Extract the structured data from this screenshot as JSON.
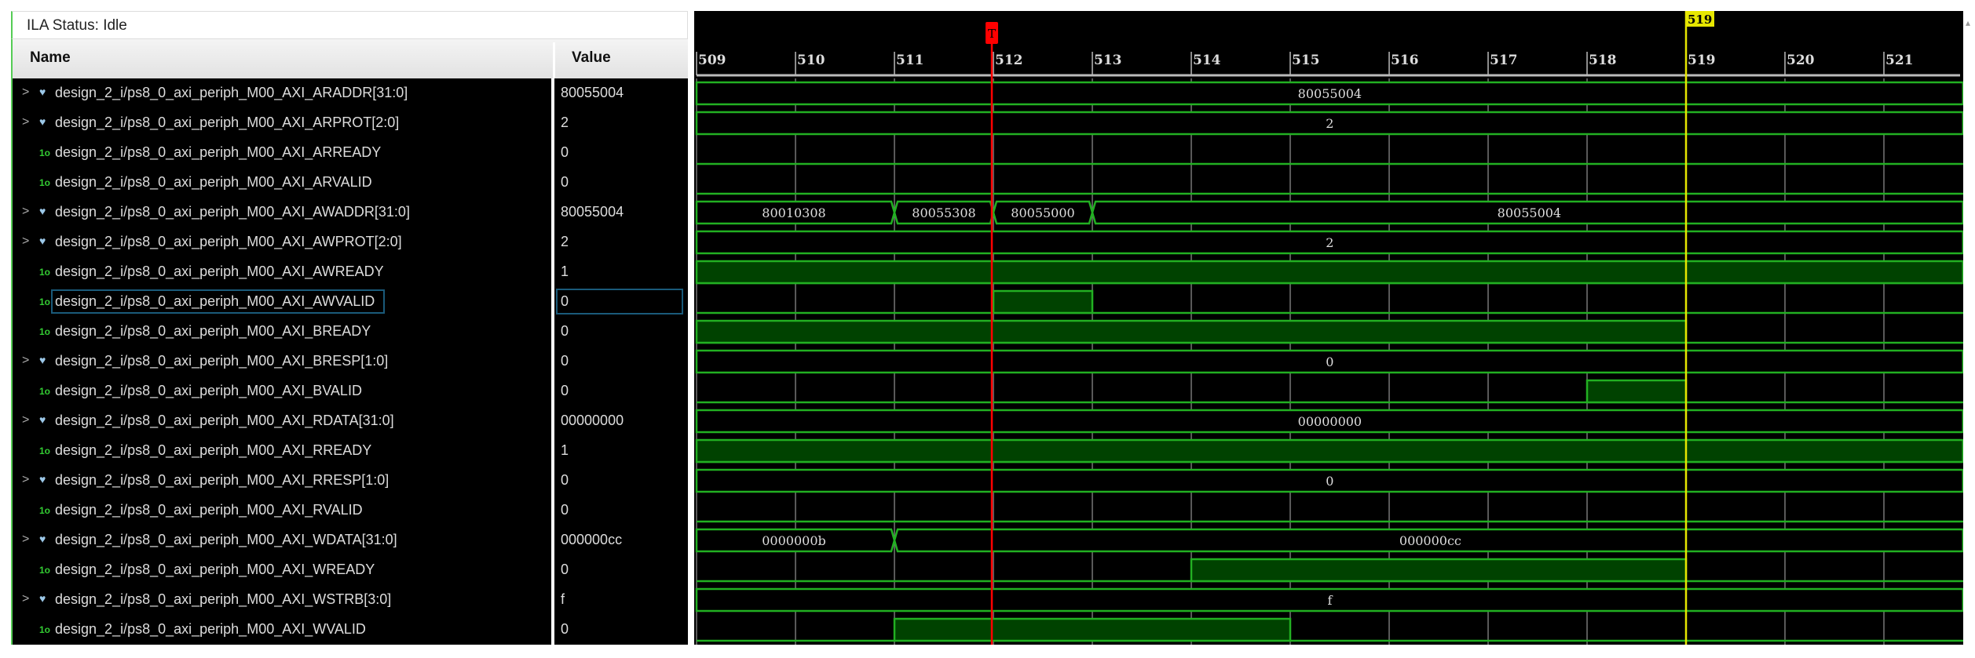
{
  "status": {
    "label": "ILA Status:",
    "value": "Idle"
  },
  "columns": {
    "name": "Name",
    "value": "Value"
  },
  "timeline": {
    "start": 509,
    "end": 521.8,
    "ticks": [
      509,
      510,
      511,
      512,
      513,
      514,
      515,
      516,
      517,
      518,
      519,
      520,
      521
    ]
  },
  "trigger_marker": {
    "label": "T",
    "time": 512,
    "color": "#ff0000"
  },
  "cursor_marker": {
    "label": "519",
    "time": 519,
    "color": "#e6e600"
  },
  "colors": {
    "wave_line": "#22b022",
    "wave_fill": "#004200",
    "grid": "#777777",
    "text": "#dddddd"
  },
  "signals": [
    {
      "name": "design_2_i/ps8_0_axi_periph_M00_AXI_ARADDR[31:0]",
      "value": "80055004",
      "type": "bus",
      "segments": [
        {
          "from": 509,
          "to": 521.8,
          "value": "80055004"
        }
      ]
    },
    {
      "name": "design_2_i/ps8_0_axi_periph_M00_AXI_ARPROT[2:0]",
      "value": "2",
      "type": "bus",
      "segments": [
        {
          "from": 509,
          "to": 521.8,
          "value": "2"
        }
      ]
    },
    {
      "name": "design_2_i/ps8_0_axi_periph_M00_AXI_ARREADY",
      "value": "0",
      "type": "bit",
      "high": []
    },
    {
      "name": "design_2_i/ps8_0_axi_periph_M00_AXI_ARVALID",
      "value": "0",
      "type": "bit",
      "high": []
    },
    {
      "name": "design_2_i/ps8_0_axi_periph_M00_AXI_AWADDR[31:0]",
      "value": "80055004",
      "type": "bus",
      "segments": [
        {
          "from": 509,
          "to": 511,
          "value": "80010308"
        },
        {
          "from": 511,
          "to": 512,
          "value": "80055308"
        },
        {
          "from": 512,
          "to": 513,
          "value": "80055000"
        },
        {
          "from": 513,
          "to": 521.8,
          "value": "80055004"
        }
      ]
    },
    {
      "name": "design_2_i/ps8_0_axi_periph_M00_AXI_AWPROT[2:0]",
      "value": "2",
      "type": "bus",
      "segments": [
        {
          "from": 509,
          "to": 521.8,
          "value": "2"
        }
      ]
    },
    {
      "name": "design_2_i/ps8_0_axi_periph_M00_AXI_AWREADY",
      "value": "1",
      "type": "bit",
      "high": [
        [
          509,
          521.8
        ]
      ]
    },
    {
      "name": "design_2_i/ps8_0_axi_periph_M00_AXI_AWVALID",
      "value": "0",
      "type": "bit",
      "high": [
        [
          512,
          513
        ]
      ],
      "selected": true
    },
    {
      "name": "design_2_i/ps8_0_axi_periph_M00_AXI_BREADY",
      "value": "0",
      "type": "bit",
      "high": [
        [
          509,
          519
        ]
      ]
    },
    {
      "name": "design_2_i/ps8_0_axi_periph_M00_AXI_BRESP[1:0]",
      "value": "0",
      "type": "bus",
      "segments": [
        {
          "from": 509,
          "to": 521.8,
          "value": "0"
        }
      ]
    },
    {
      "name": "design_2_i/ps8_0_axi_periph_M00_AXI_BVALID",
      "value": "0",
      "type": "bit",
      "high": [
        [
          518,
          519
        ]
      ]
    },
    {
      "name": "design_2_i/ps8_0_axi_periph_M00_AXI_RDATA[31:0]",
      "value": "00000000",
      "type": "bus",
      "segments": [
        {
          "from": 509,
          "to": 521.8,
          "value": "00000000"
        }
      ]
    },
    {
      "name": "design_2_i/ps8_0_axi_periph_M00_AXI_RREADY",
      "value": "1",
      "type": "bit",
      "high": [
        [
          509,
          521.8
        ]
      ]
    },
    {
      "name": "design_2_i/ps8_0_axi_periph_M00_AXI_RRESP[1:0]",
      "value": "0",
      "type": "bus",
      "segments": [
        {
          "from": 509,
          "to": 521.8,
          "value": "0"
        }
      ]
    },
    {
      "name": "design_2_i/ps8_0_axi_periph_M00_AXI_RVALID",
      "value": "0",
      "type": "bit",
      "high": []
    },
    {
      "name": "design_2_i/ps8_0_axi_periph_M00_AXI_WDATA[31:0]",
      "value": "000000cc",
      "type": "bus",
      "segments": [
        {
          "from": 509,
          "to": 511,
          "value": "0000000b"
        },
        {
          "from": 511,
          "to": 521.8,
          "value": "000000cc"
        }
      ]
    },
    {
      "name": "design_2_i/ps8_0_axi_periph_M00_AXI_WREADY",
      "value": "0",
      "type": "bit",
      "high": [
        [
          514,
          519
        ]
      ]
    },
    {
      "name": "design_2_i/ps8_0_axi_periph_M00_AXI_WSTRB[3:0]",
      "value": "f",
      "type": "bus",
      "segments": [
        {
          "from": 509,
          "to": 521.8,
          "value": "f"
        }
      ]
    },
    {
      "name": "design_2_i/ps8_0_axi_periph_M00_AXI_WVALID",
      "value": "0",
      "type": "bit",
      "high": [
        [
          511,
          515
        ]
      ]
    }
  ]
}
